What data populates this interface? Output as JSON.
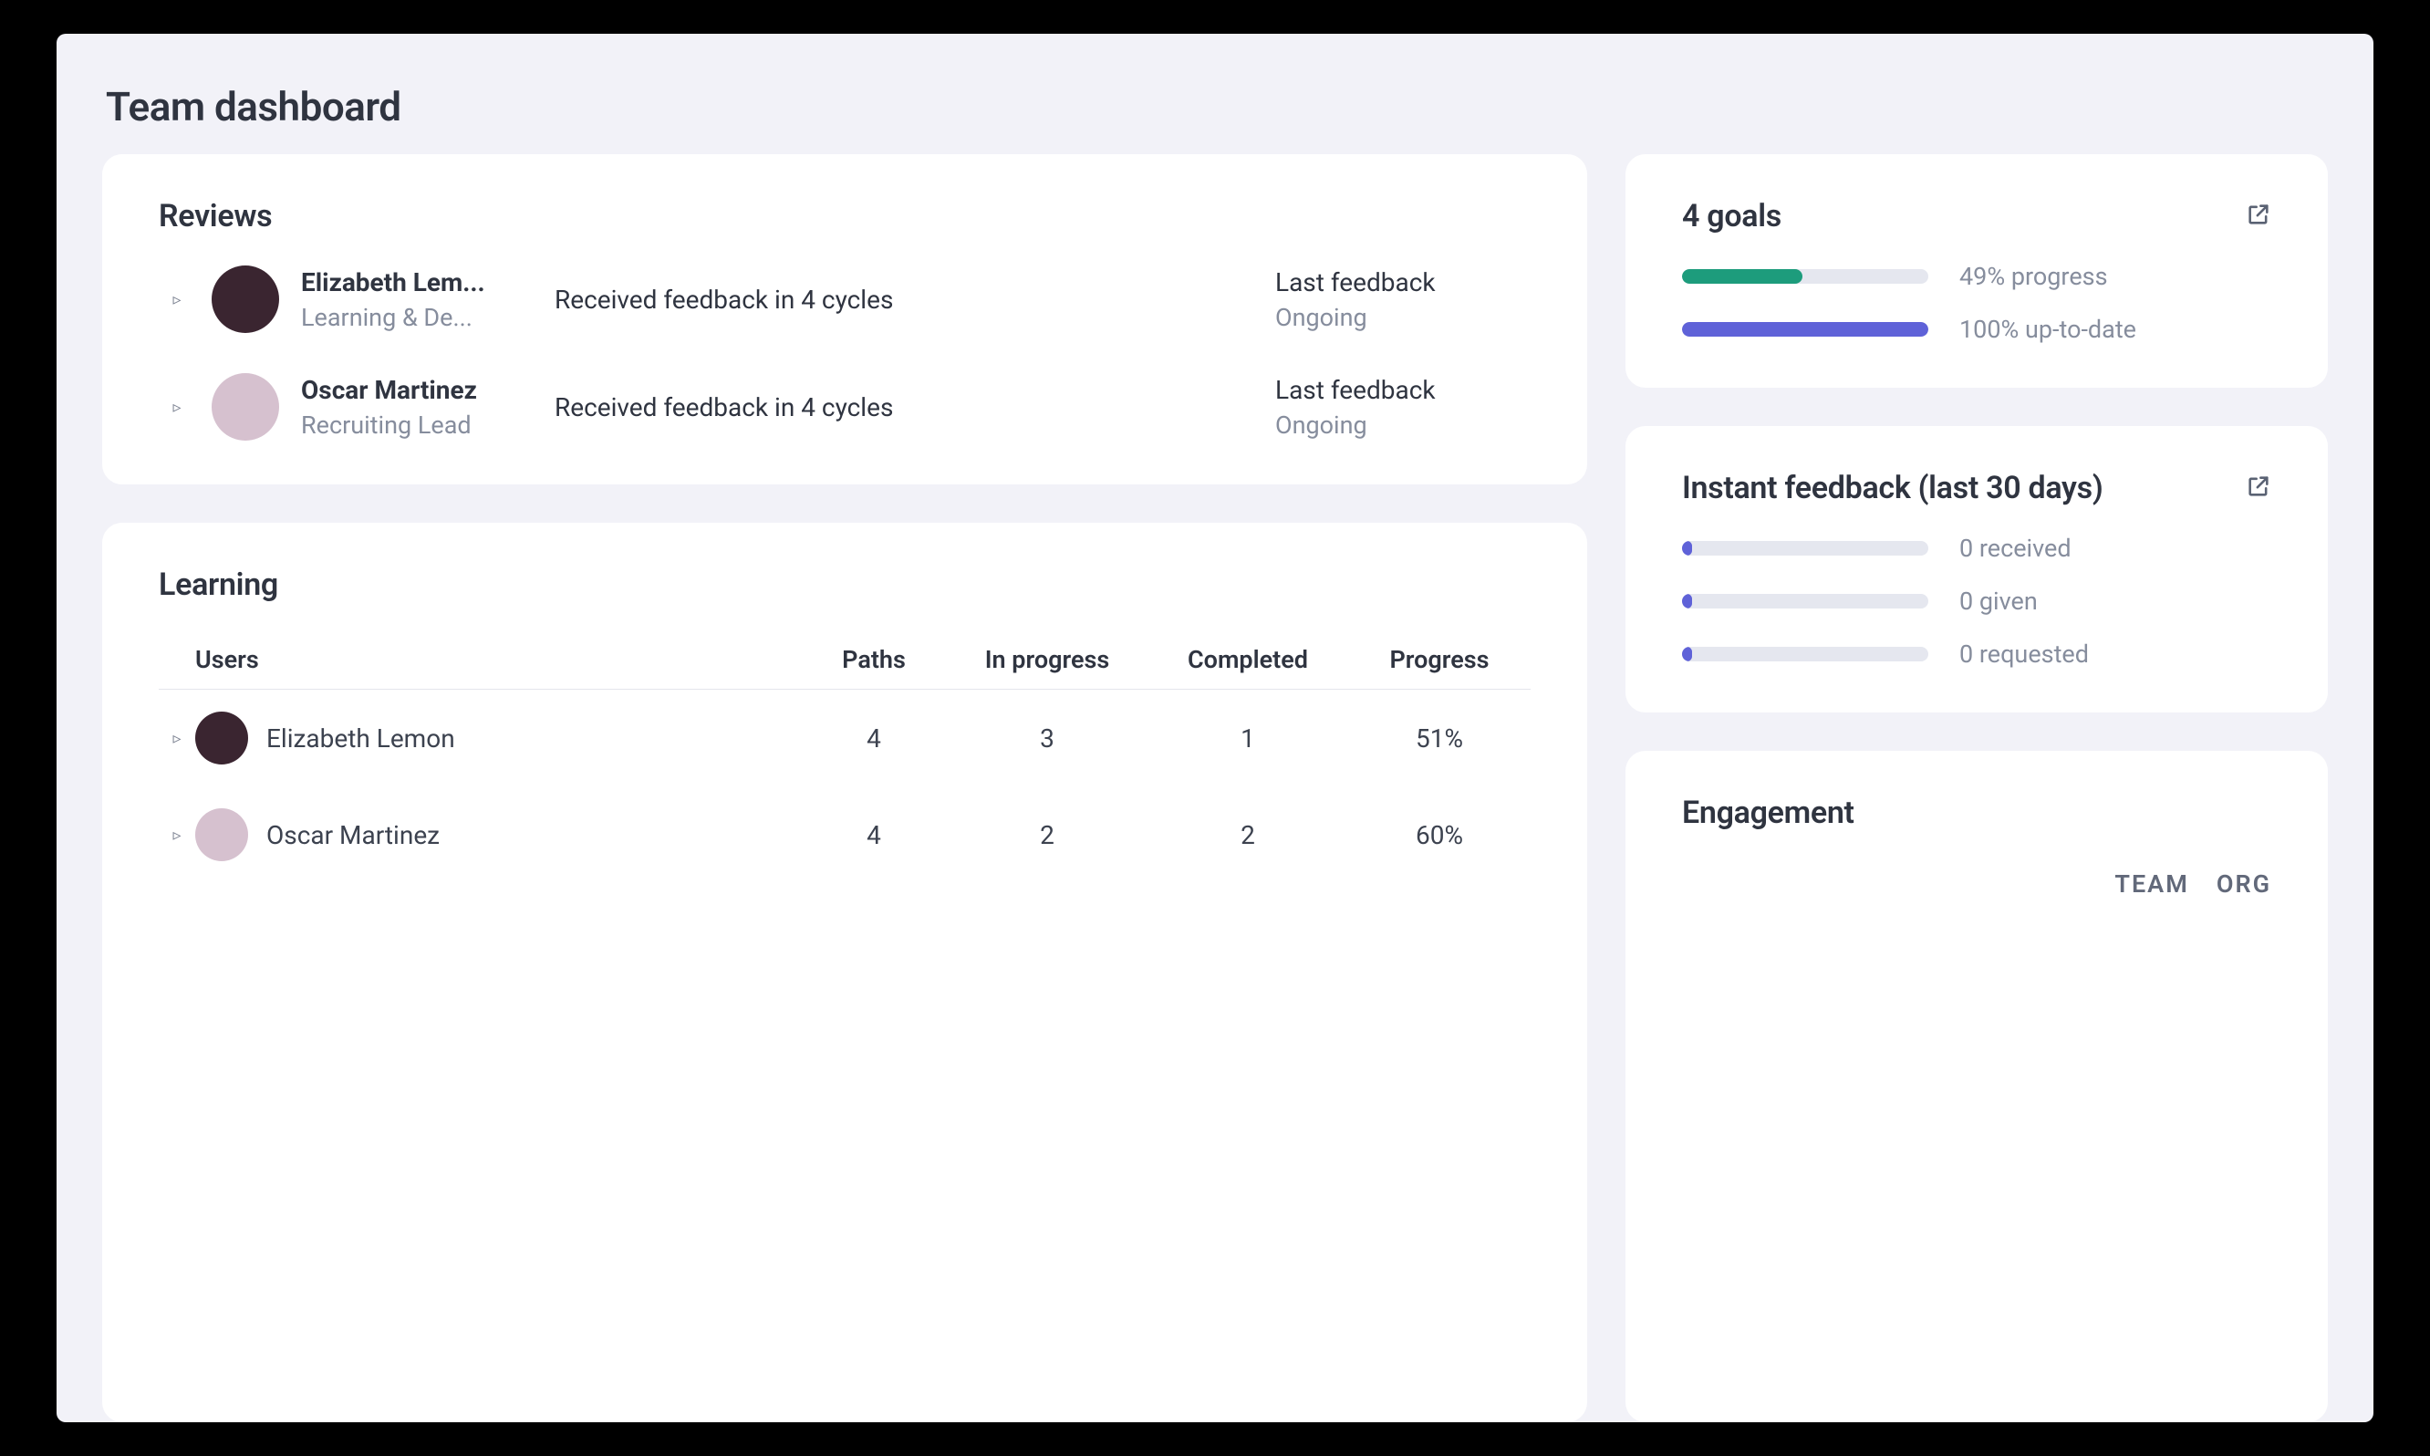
{
  "page_title": "Team dashboard",
  "reviews": {
    "title": "Reviews",
    "items": [
      {
        "name": "Elizabeth Lem...",
        "subtitle": "Learning & De...",
        "feedback_text": "Received feedback in 4 cycles",
        "last_label": "Last feedback",
        "last_value": "Ongoing",
        "avatar_bg": "#3a2530"
      },
      {
        "name": "Oscar Martinez",
        "subtitle": "Recruiting Lead",
        "feedback_text": "Received feedback in 4 cycles",
        "last_label": "Last feedback",
        "last_value": "Ongoing",
        "avatar_bg": "#d6c1cf"
      }
    ]
  },
  "learning": {
    "title": "Learning",
    "columns": {
      "users": "Users",
      "paths": "Paths",
      "in_progress": "In progress",
      "completed": "Completed",
      "progress": "Progress"
    },
    "rows": [
      {
        "name": "Elizabeth Lemon",
        "paths": "4",
        "in_progress": "3",
        "completed": "1",
        "progress": "51%",
        "avatar_bg": "#3a2530"
      },
      {
        "name": "Oscar Martinez",
        "paths": "4",
        "in_progress": "2",
        "completed": "2",
        "progress": "60%",
        "avatar_bg": "#d6c1cf"
      }
    ]
  },
  "goals": {
    "title": "4 goals",
    "stats": [
      {
        "label": "49% progress",
        "percent": 49,
        "color": "green"
      },
      {
        "label": "100% up-to-date",
        "percent": 100,
        "color": "purple"
      }
    ]
  },
  "instant_feedback": {
    "title": "Instant feedback (last 30 days)",
    "stats": [
      {
        "label": "0 received",
        "percent": 4,
        "color": "purple"
      },
      {
        "label": "0 given",
        "percent": 4,
        "color": "purple"
      },
      {
        "label": "0 requested",
        "percent": 4,
        "color": "purple"
      }
    ]
  },
  "engagement": {
    "title": "Engagement",
    "tabs": [
      "TEAM",
      "ORG"
    ]
  }
}
